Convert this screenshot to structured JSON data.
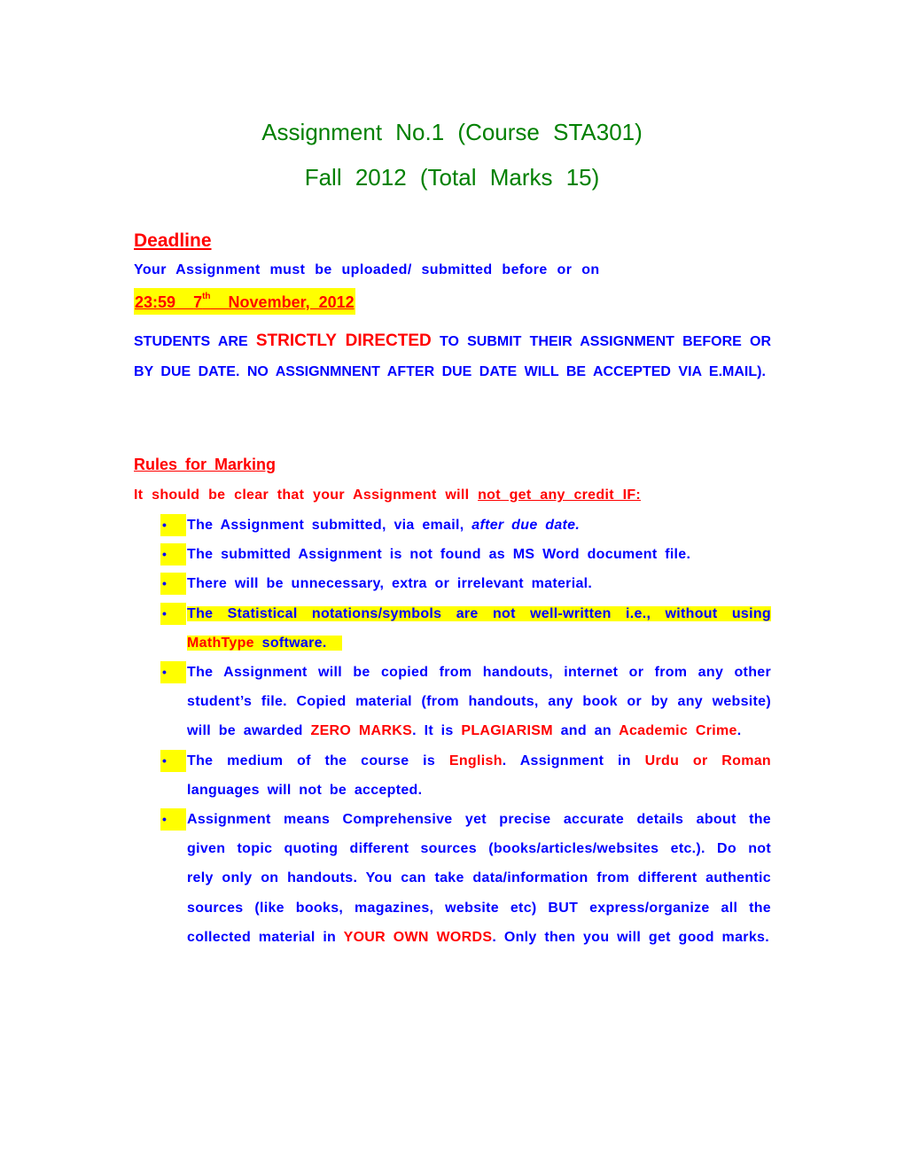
{
  "header": {
    "title_line1": "Assignment  No.1  (Course  STA301)",
    "title_line2": "Fall  2012  (Total  Marks  15)"
  },
  "deadline": {
    "heading": "Deadline",
    "text": "Your Assignment must be uploaded/ submitted before or on",
    "date_time": "23:59",
    "date_day": "7",
    "date_suffix": "th",
    "date_rest": "November, 2012"
  },
  "notice": {
    "part1": "STUDENTS ARE ",
    "emphasis": "STRICTLY DIRECTED",
    "part2": " TO SUBMIT THEIR ASSIGNMENT BEFORE OR BY DUE DATE. NO ASSIGNMNENT AFTER DUE DATE WILL BE ACCEPTED VIA E.MAIL)."
  },
  "rules": {
    "heading": "Rules for Marking",
    "intro": "It should be clear that your Assignment will ",
    "intro_underlined": "not get any credit IF:",
    "bullet_glyph": "•",
    "items": [
      {
        "a": "The Assignment submitted, via email, ",
        "b": "after due date."
      },
      {
        "a": "The submitted Assignment is not found as MS Word document file."
      },
      {
        "a": "There will be unnecessary, extra or irrelevant material."
      },
      {
        "a": "The Statistical notations/symbols are not well-written i.e., without using ",
        "red1": "MathType",
        "b": " software."
      },
      {
        "a": "The Assignment will be copied from handouts, internet or from any other student’s file. Copied material (from handouts, any book or by any website) will be awarded ",
        "red1": "ZERO MARKS",
        "b": ". It is ",
        "red2": "PLAGIARISM",
        "c": " and an ",
        "red3": "Academic Crime",
        "d": "."
      },
      {
        "a": "The medium of the course is ",
        "red1": "English",
        "b": ". Assignment in ",
        "red2": "Urdu or Roman",
        "c": " languages will not be accepted."
      },
      {
        "a": "Assignment means Comprehensive yet precise accurate details about the given topic quoting different sources (books/articles/websites etc.). Do not rely only on handouts. You can take data/information from different authentic sources (like books, magazines, website etc) BUT express/organize all the collected material in ",
        "red1": "YOUR OWN WORDS",
        "b": ". Only then you will get good marks."
      }
    ]
  },
  "colors": {
    "title": "#008000",
    "emphasis": "#ff0000",
    "body": "#0000ff",
    "highlight": "#ffff00"
  }
}
